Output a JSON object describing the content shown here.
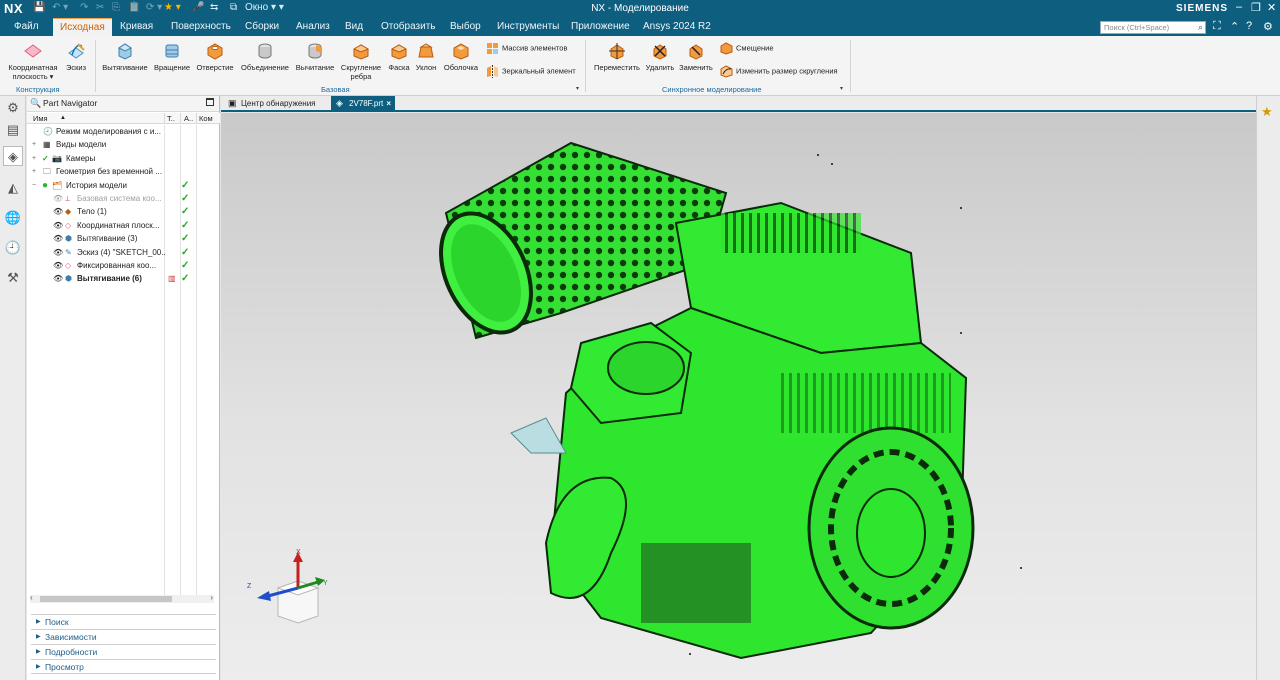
{
  "titlebar": {
    "logo": "NX",
    "window_menu": "Окно",
    "title": "NX - Моделирование",
    "brand": "SIEMENS"
  },
  "menu": {
    "items": [
      "Файл",
      "Исходная",
      "Кривая",
      "Поверхность",
      "Сборки",
      "Анализ",
      "Вид",
      "Отобразить",
      "Выбор",
      "Инструменты",
      "Приложение",
      "Ansys 2024 R2"
    ],
    "active": "Исходная",
    "search_placeholder": "Поиск (Ctrl+Space)"
  },
  "ribbon": {
    "construction": {
      "datum_plane_l1": "Координатная",
      "datum_plane_l2": "плоскость ▾",
      "sketch": "Эскиз",
      "group": "Конструкция"
    },
    "base": {
      "extrude": "Вытягивание",
      "revolve": "Вращение",
      "hole": "Отверстие",
      "unite": "Объединение",
      "subtract": "Вычитание",
      "edge_blend_l1": "Скругление",
      "edge_blend_l2": "ребра",
      "chamfer": "Фаска",
      "draft": "Уклон",
      "shell": "Оболочка",
      "pattern": "Массив элементов",
      "mirror": "Зеркальный элемент",
      "group": "Базовая"
    },
    "sync": {
      "move": "Переместить",
      "delete": "Удалить",
      "replace": "Заменить",
      "offset": "Смещение",
      "resize_blend": "Изменить размер скругления",
      "group": "Синхронное моделирование"
    }
  },
  "navigator": {
    "title": "Part Navigator",
    "columns": {
      "name": "Имя",
      "t": "Т..",
      "a": "А..",
      "k": "Ком"
    },
    "rows": [
      {
        "label": "Режим моделирования с и...",
        "check": ""
      },
      {
        "label": "Виды модели",
        "check": ""
      },
      {
        "label": "Камеры",
        "check": ""
      },
      {
        "label": "Геометрия без временной ...",
        "check": ""
      },
      {
        "label": "История модели",
        "check": "✓"
      },
      {
        "label": "Базовая система коо...",
        "check": "✓"
      },
      {
        "label": "Тело (1)",
        "check": "✓"
      },
      {
        "label": "Координатная плоск...",
        "check": "✓"
      },
      {
        "label": "Вытягивание (3)",
        "check": "✓"
      },
      {
        "label": "Эскиз (4) \"SKETCH_00...",
        "check": "✓"
      },
      {
        "label": "Фиксированная коо...",
        "check": "✓"
      },
      {
        "label": "Вытягивание (6)",
        "check": "✓"
      }
    ],
    "panels": [
      "Поиск",
      "Зависимости",
      "Подробности",
      "Просмотр"
    ]
  },
  "tabs": [
    {
      "label": "Центр обнаружения",
      "active": false
    },
    {
      "label": "2V78F.prt",
      "active": true
    }
  ],
  "triad": {
    "x": "X",
    "y": "Y",
    "z": "Z"
  },
  "colors": {
    "accent": "#0e5f7f",
    "model": "#2ee62e",
    "active_tab_text": "#d35f00"
  }
}
